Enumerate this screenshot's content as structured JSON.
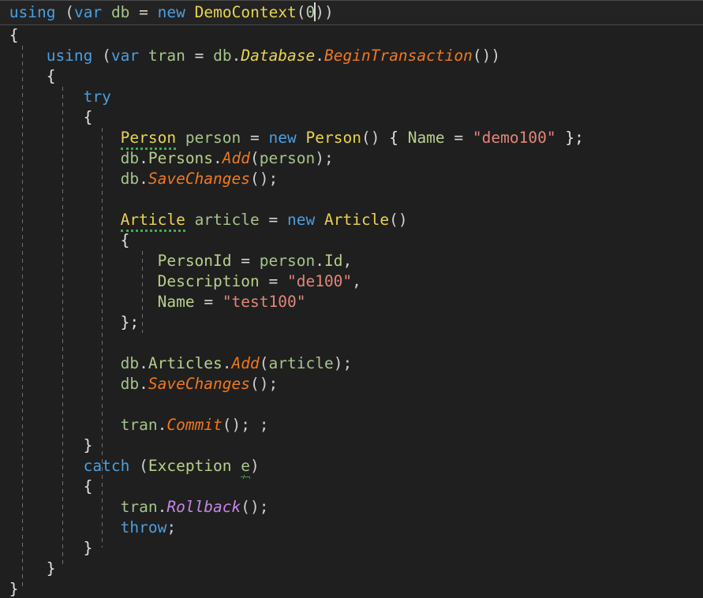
{
  "editor": {
    "background_color": "#1f1f1f",
    "current_line_background": "#232323",
    "current_line_border_color": "#4a4a4a",
    "indent_guide_color": "#6f6f6f",
    "caret_color": "#d8d8d8",
    "squiggle_color": "#3fae4e",
    "language": "C#",
    "font_size_px": 19.5,
    "line_height_px": 26,
    "cursor": {
      "line": 1,
      "column": 31,
      "after_text": "0"
    }
  },
  "colors": {
    "keyword": "#4a9fe0",
    "type": "#e8d44d",
    "local_variable": "#a6c48a",
    "property": "#b9cf8c",
    "method": "#f0791a",
    "method_alt": "#c586e8",
    "string": "#e2867a",
    "number": "#b5cea8",
    "punctuation": "#d6d6d6"
  },
  "code": {
    "lines": [
      "using (var db = new DemoContext(0))",
      "{",
      "    using (var tran = db.Database.BeginTransaction())",
      "    {",
      "        try",
      "        {",
      "            Person person = new Person() { Name = \"demo100\" };",
      "            db.Persons.Add(person);",
      "            db.SaveChanges();",
      "",
      "            Article article = new Article()",
      "            {",
      "                PersonId = person.Id,",
      "                Description = \"de100\",",
      "                Name = \"test100\"",
      "            };",
      "",
      "            db.Articles.Add(article);",
      "            db.SaveChanges();",
      "",
      "            tran.Commit(); ;",
      "        }",
      "        catch (Exception e)",
      "        {",
      "            tran.Rollback();",
      "            throw;",
      "        }",
      "    }",
      "}"
    ],
    "tokens": {
      "kw_using": "using",
      "kw_var": "var",
      "kw_new": "new",
      "kw_try": "try",
      "kw_catch": "catch",
      "kw_throw": "throw",
      "type_democontext": "DemoContext",
      "type_person": "Person",
      "type_article": "Article",
      "type_exception": "Exception",
      "var_db": "db",
      "var_tran": "tran",
      "var_person": "person",
      "var_article": "article",
      "var_e": "e",
      "prop_database": "Database",
      "prop_persons": "Persons",
      "prop_articles": "Articles",
      "prop_id": "Id",
      "prop_name": "Name",
      "prop_personid": "PersonId",
      "prop_description": "Description",
      "m_begintransaction": "BeginTransaction",
      "m_add": "Add",
      "m_savechanges": "SaveChanges",
      "m_commit": "Commit",
      "m_rollback": "Rollback",
      "str_demo100": "\"demo100\"",
      "str_de100": "\"de100\"",
      "str_test100": "\"test100\"",
      "num_zero": "0",
      "p_open": "(",
      "p_close": ")",
      "p_open_close": "()",
      "p_close2": "))",
      "p_semi": ";",
      "p_semi_semi": "; ;",
      "p_eq": "=",
      "p_dot": ".",
      "p_comma": ",",
      "p_brace_open": "{",
      "p_brace_close": "}",
      "p_brace_close_semi": "};",
      "p_space": " "
    },
    "diagnostics": [
      {
        "text": "Person",
        "line": 7,
        "style": "dotted",
        "color": "#3fae4e"
      },
      {
        "text": "Article",
        "line": 11,
        "style": "dotted",
        "color": "#3fae4e"
      },
      {
        "text": "e",
        "line": 23,
        "style": "wavy",
        "color": "#3fae4e"
      }
    ]
  }
}
